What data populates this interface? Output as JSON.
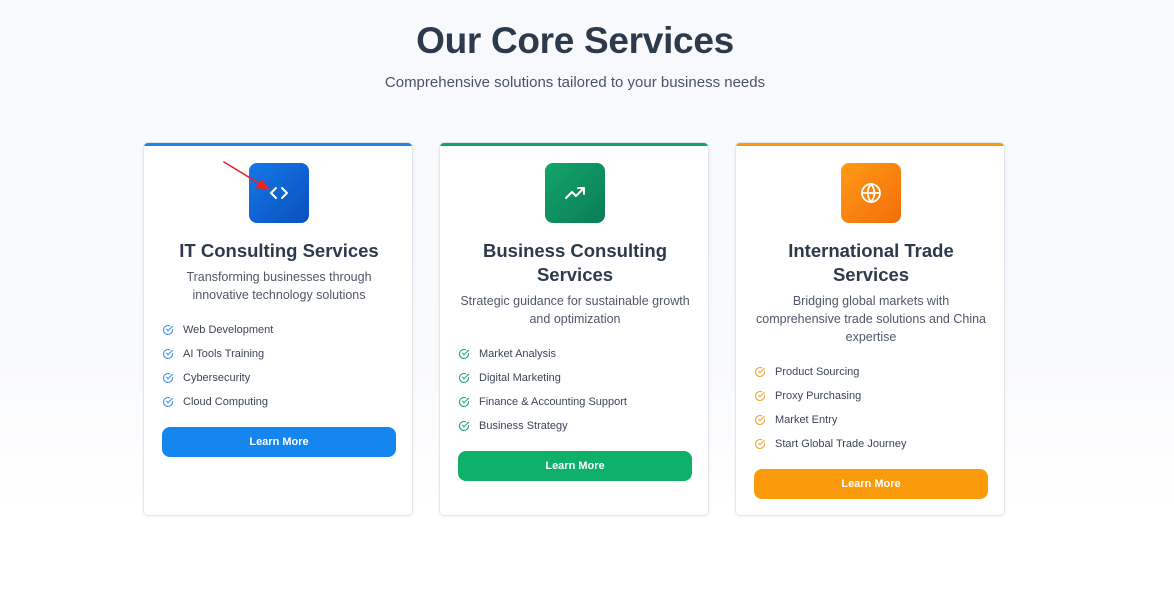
{
  "header": {
    "title": "Our Core Services",
    "subtitle": "Comprehensive solutions tailored to your business needs"
  },
  "cards": [
    {
      "icon": "code-icon",
      "accent_color": "#1f84e5",
      "icon_gradient": [
        "#1479e6",
        "#0a4fbf"
      ],
      "button_color": "#1585ef",
      "check_color": "#3b8ee0",
      "title": "IT Consulting Services",
      "description": "Transforming businesses through innovative technology solutions",
      "features": [
        "Web Development",
        "AI Tools Training",
        "Cybersecurity",
        "Cloud Computing"
      ],
      "button_label": "Learn More"
    },
    {
      "icon": "trending-up-icon",
      "accent_color": "#12a466",
      "icon_gradient": [
        "#13a56a",
        "#0b7c55"
      ],
      "button_color": "#0fb06a",
      "check_color": "#16a66a",
      "title": "Business Consulting Services",
      "description": "Strategic guidance for sustainable growth and optimization",
      "features": [
        "Market Analysis",
        "Digital Marketing",
        "Finance & Accounting Support",
        "Business Strategy"
      ],
      "button_label": "Learn More"
    },
    {
      "icon": "globe-icon",
      "accent_color": "#f7980f",
      "icon_gradient": [
        "#ff9a16",
        "#f36e0a"
      ],
      "button_color": "#fb9a0a",
      "check_color": "#f3a12a",
      "title": "International Trade Services",
      "description": "Bridging global markets with comprehensive trade solutions and China expertise",
      "features": [
        "Product Sourcing",
        "Proxy Purchasing",
        "Market Entry",
        "Start Global Trade Journey"
      ],
      "button_label": "Learn More"
    }
  ],
  "annotation": {
    "icon": "red-arrow-icon",
    "color": "#e3262b"
  }
}
